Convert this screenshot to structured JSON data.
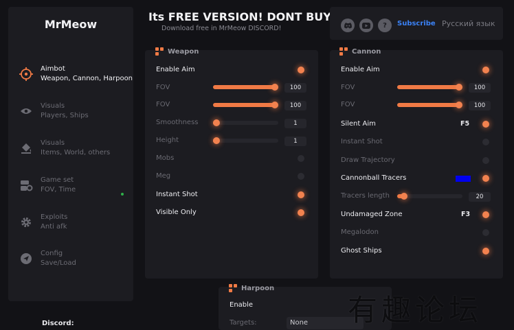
{
  "app": {
    "title": "MrMeow"
  },
  "header": {
    "title": "Its FREE VERSION! DONT BUY",
    "subtitle": "Download free in MrMeow DISCORD!"
  },
  "topbar": {
    "icons": [
      "discord-icon",
      "youtube-icon",
      "help-icon"
    ],
    "subscribe": "Subscribe",
    "language": "Русский язык"
  },
  "sidebar": {
    "items": [
      {
        "line1": "Aimbot",
        "line2": "Weapon, Cannon, Harpoon",
        "icon": "crosshair-icon",
        "active": true
      },
      {
        "line1": "Visuals",
        "line2": "Players, Ships",
        "icon": "eye-icon",
        "active": false
      },
      {
        "line1": "Visuals",
        "line2": "Items, World, others",
        "icon": "paint-bucket-icon",
        "active": false
      },
      {
        "line1": "Game set",
        "line2": "FOV, Time",
        "icon": "game-settings-icon",
        "active": false
      },
      {
        "line1": "Exploits",
        "line2": "Anti afk",
        "icon": "gear-icon",
        "active": false
      },
      {
        "line1": "Config",
        "line2": "Save/Load",
        "icon": "send-icon",
        "active": false
      }
    ],
    "discord_label": "Discord:"
  },
  "weapon": {
    "title": "Weapon",
    "enable_aim": {
      "label": "Enable Aim",
      "on": true
    },
    "fov1": {
      "label": "FOV",
      "value": "100",
      "fraction": 1.0
    },
    "fov2": {
      "label": "FOV",
      "value": "100",
      "fraction": 1.0
    },
    "smoothness": {
      "label": "Smoothness",
      "value": "1",
      "fraction": 0.0
    },
    "height": {
      "label": "Height",
      "value": "1",
      "fraction": 0.0
    },
    "mobs": {
      "label": "Mobs",
      "on": false
    },
    "meg": {
      "label": "Meg",
      "on": false
    },
    "instant_shot": {
      "label": "Instant Shot",
      "on": true
    },
    "visible_only": {
      "label": "Visible Only",
      "on": true
    }
  },
  "cannon": {
    "title": "Cannon",
    "enable_aim": {
      "label": "Enable Aim",
      "on": true
    },
    "fov1": {
      "label": "FOV",
      "value": "100",
      "fraction": 1.0
    },
    "fov2": {
      "label": "FOV",
      "value": "100",
      "fraction": 1.0
    },
    "silent_aim": {
      "label": "Silent Aim",
      "key": "F5",
      "on": true
    },
    "instant_shot": {
      "label": "Instant Shot",
      "on": false
    },
    "draw_trajectory": {
      "label": "Draw Trajectory",
      "on": false
    },
    "cannonball_tracers": {
      "label": "Cannonball Tracers",
      "color": "#0000ee",
      "on": true
    },
    "tracers_length": {
      "label": "Tracers length",
      "value": "20",
      "fraction": 0.1
    },
    "undamaged_zone": {
      "label": "Undamaged Zone",
      "key": "F3",
      "on": true
    },
    "megalodon": {
      "label": "Megalodon",
      "on": false
    },
    "ghost_ships": {
      "label": "Ghost Ships",
      "on": true
    }
  },
  "harpoon": {
    "title": "Harpoon",
    "enable": {
      "label": "Enable"
    },
    "targets": {
      "label": "Targets:",
      "value": "None"
    }
  },
  "watermark": "有趣论坛",
  "colors": {
    "accent": "#f07a45",
    "panel": "#1c1c21",
    "background": "#121216",
    "link": "#3b82f6"
  }
}
